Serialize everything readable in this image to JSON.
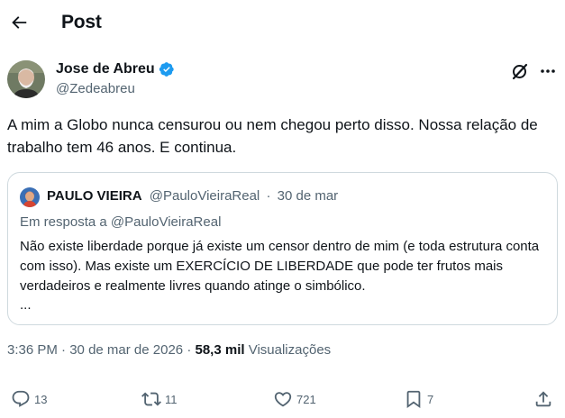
{
  "header": {
    "title": "Post",
    "back_icon": "arrow-left-icon"
  },
  "author": {
    "name": "Jose de Abreu",
    "handle": "@Zedeabreu",
    "verified_color": "#1d9bf0"
  },
  "tweet": {
    "text": "A mim a Globo nunca censurou ou nem chegou perto disso. Nossa relação de trabalho tem 46 anos. E continua."
  },
  "quote": {
    "name": "PAULO VIEIRA",
    "handle": "@PauloVieiraReal",
    "separator": "·",
    "date": "30 de mar",
    "reply_prefix": "Em resposta a",
    "reply_handle": "@PauloVieiraReal",
    "text": "Não existe liberdade porque já existe um censor dentro de mim (e toda estrutura conta com isso). Mas existe um EXERCÍCIO DE LIBERDADE que pode ter frutos mais verdadeiros e realmente livres quando atinge o simbólico.",
    "ellipsis": "..."
  },
  "meta": {
    "time": "3:36 PM",
    "separator": "·",
    "date": "30 de mar de 2026",
    "separator2": "·",
    "views_count": "58,3 mil",
    "views_label": "Visualizações"
  },
  "actions": {
    "replies": "13",
    "reposts": "11",
    "likes": "721",
    "bookmarks": "7"
  },
  "colors": {
    "text": "#0f1419",
    "secondary": "#536471",
    "border": "#cfd9de",
    "accent": "#1d9bf0"
  }
}
